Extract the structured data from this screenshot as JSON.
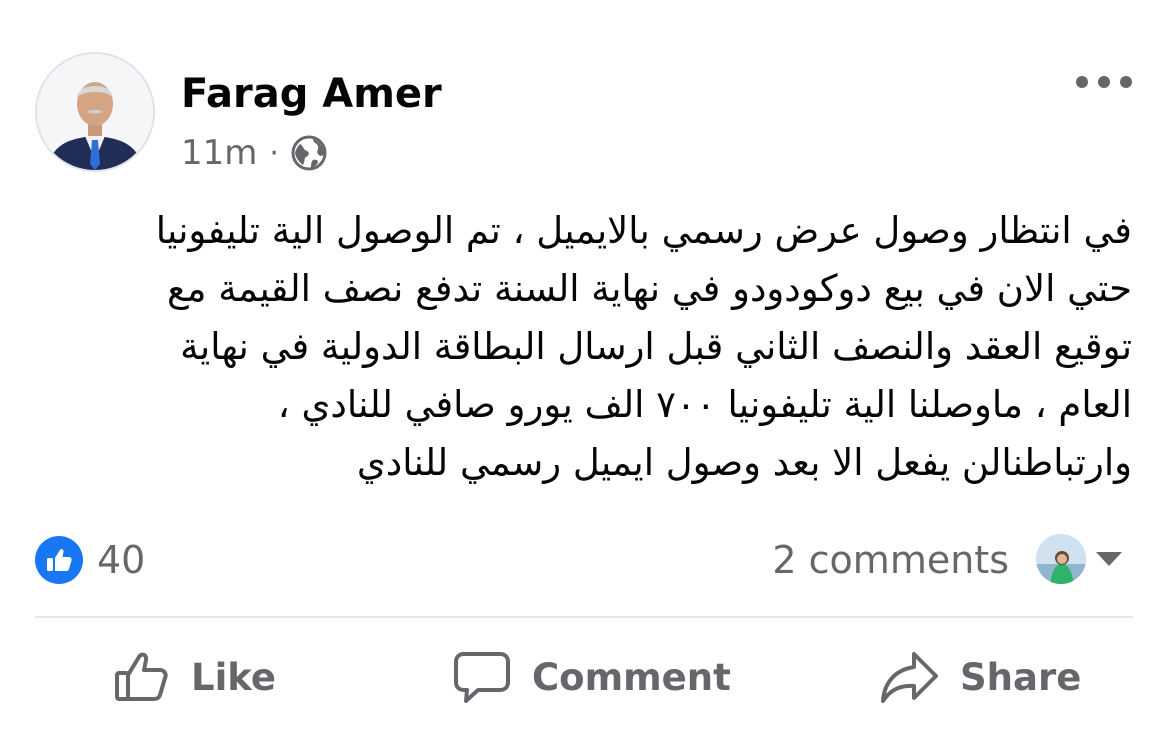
{
  "post": {
    "author": "Farag Amer",
    "time": "11m",
    "separator": "·",
    "audience_icon": "globe-icon",
    "more_icon": "more-options-icon",
    "text": "في انتظار وصول عرض  رسمي بالايميل ، تم الوصول الية تليفونيا\nحتي الان في بيع دوكودودو في نهاية السنة تدفع نصف القيمة مع\nتوقيع العقد والنصف الثاني قبل ارسال البطاقة الدولية  في نهاية\nالعام ، ماوصلنا الية تليفونيا ٧٠٠ الف يورو صافي للنادي ،\nوارتباطنالن يفعل الا بعد وصول ايميل  رسمي للنادي"
  },
  "reactions": {
    "like_count": "40",
    "comments_label": "2 comments"
  },
  "actions": {
    "like_label": "Like",
    "comment_label": "Comment",
    "share_label": "Share"
  },
  "colors": {
    "accent": "#1877f2",
    "secondary_text": "#65676b",
    "primary_text": "#050505",
    "divider": "#e4e6eb"
  }
}
